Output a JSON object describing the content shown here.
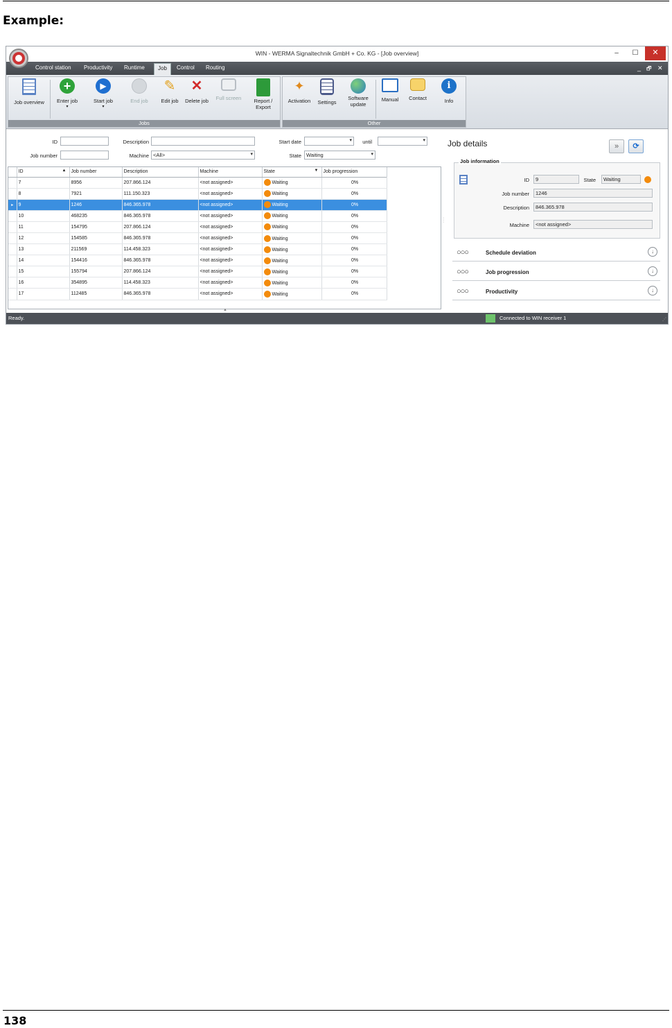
{
  "doc": {
    "heading": "Example:",
    "page_number": "138"
  },
  "window": {
    "title": "WIN - WERMA Signaltechnik GmbH + Co. KG - [Job overview]",
    "minimize": "–",
    "maximize": "☐",
    "close": "✕"
  },
  "menu": {
    "items": [
      {
        "label": "Control station"
      },
      {
        "label": "Productivity"
      },
      {
        "label": "Runtime"
      },
      {
        "label": "Job"
      },
      {
        "label": "Control"
      },
      {
        "label": "Routing"
      }
    ],
    "mdi_min": "_",
    "mdi_restore": "🗗",
    "mdi_close": "✕"
  },
  "ribbon": {
    "jobs_group": "Jobs",
    "other_group": "Other",
    "buttons": {
      "job_overview": "Job overview",
      "enter_job": "Enter job",
      "start_job": "Start job",
      "end_job": "End job",
      "edit_job": "Edit job",
      "delete_job": "Delete job",
      "full_screen": "Full screen",
      "report_export": "Report / Export",
      "activation": "Activation",
      "settings": "Settings",
      "software_update": "Software update",
      "manual": "Manual",
      "contact": "Contact",
      "info": "Info"
    },
    "colors": {
      "enter": "#2fa33a",
      "start": "#1f6fd0",
      "end": "#c9ced3",
      "report": "#2d9a3a",
      "info": "#1d72c9"
    }
  },
  "filters": {
    "id_label": "ID",
    "id_value": "",
    "job_number_label": "Job number",
    "job_number_value": "",
    "description_label": "Description",
    "description_value": "",
    "machine_label": "Machine",
    "machine_value": "<All>",
    "start_date_label": "Start date",
    "start_date_value": "",
    "until_label": "until",
    "until_value": "",
    "state_label": "State",
    "state_value": "Waiting"
  },
  "grid": {
    "columns": [
      "ID",
      "Job number",
      "Description",
      "Machine",
      "State",
      "Job progression"
    ],
    "rows": [
      {
        "id": "7",
        "job": "8956",
        "desc": "207.866.124",
        "machine": "<not assigned>",
        "state": "Waiting",
        "prog": "0%"
      },
      {
        "id": "8",
        "job": "7921",
        "desc": "111.150.323",
        "machine": "<not assigned>",
        "state": "Waiting",
        "prog": "0%"
      },
      {
        "id": "9",
        "job": "1246",
        "desc": "846.365.978",
        "machine": "<not assigned>",
        "state": "Waiting",
        "prog": "0%"
      },
      {
        "id": "10",
        "job": "468235",
        "desc": "846.365.978",
        "machine": "<not assigned>",
        "state": "Waiting",
        "prog": "0%"
      },
      {
        "id": "11",
        "job": "154795",
        "desc": "207.866.124",
        "machine": "<not assigned>",
        "state": "Waiting",
        "prog": "0%"
      },
      {
        "id": "12",
        "job": "154585",
        "desc": "846.365.978",
        "machine": "<not assigned>",
        "state": "Waiting",
        "prog": "0%"
      },
      {
        "id": "13",
        "job": "211569",
        "desc": "114.458.323",
        "machine": "<not assigned>",
        "state": "Waiting",
        "prog": "0%"
      },
      {
        "id": "14",
        "job": "154416",
        "desc": "846.365.978",
        "machine": "<not assigned>",
        "state": "Waiting",
        "prog": "0%"
      },
      {
        "id": "15",
        "job": "155794",
        "desc": "207.866.124",
        "machine": "<not assigned>",
        "state": "Waiting",
        "prog": "0%"
      },
      {
        "id": "16",
        "job": "354895",
        "desc": "114.458.323",
        "machine": "<not assigned>",
        "state": "Waiting",
        "prog": "0%"
      },
      {
        "id": "17",
        "job": "112485",
        "desc": "846.365.978",
        "machine": "<not assigned>",
        "state": "Waiting",
        "prog": "0%"
      }
    ]
  },
  "details": {
    "title": "Job details",
    "info_title": "Job information",
    "id_label": "ID",
    "id_value": "9",
    "state_label": "State",
    "state_value": "Waiting",
    "job_number_label": "Job number",
    "job_number_value": "1246",
    "description_label": "Description",
    "description_value": "846.365.978",
    "machine_label": "Machine",
    "machine_value": "<not assigned>",
    "sections": [
      {
        "label": "Schedule deviation"
      },
      {
        "label": "Job progression"
      },
      {
        "label": "Productivity"
      }
    ],
    "state_color": "#f38b0c"
  },
  "status": {
    "left": "Ready.",
    "right": "Connected to WIN receiver 1",
    "connected_color": "#6ec36b"
  }
}
